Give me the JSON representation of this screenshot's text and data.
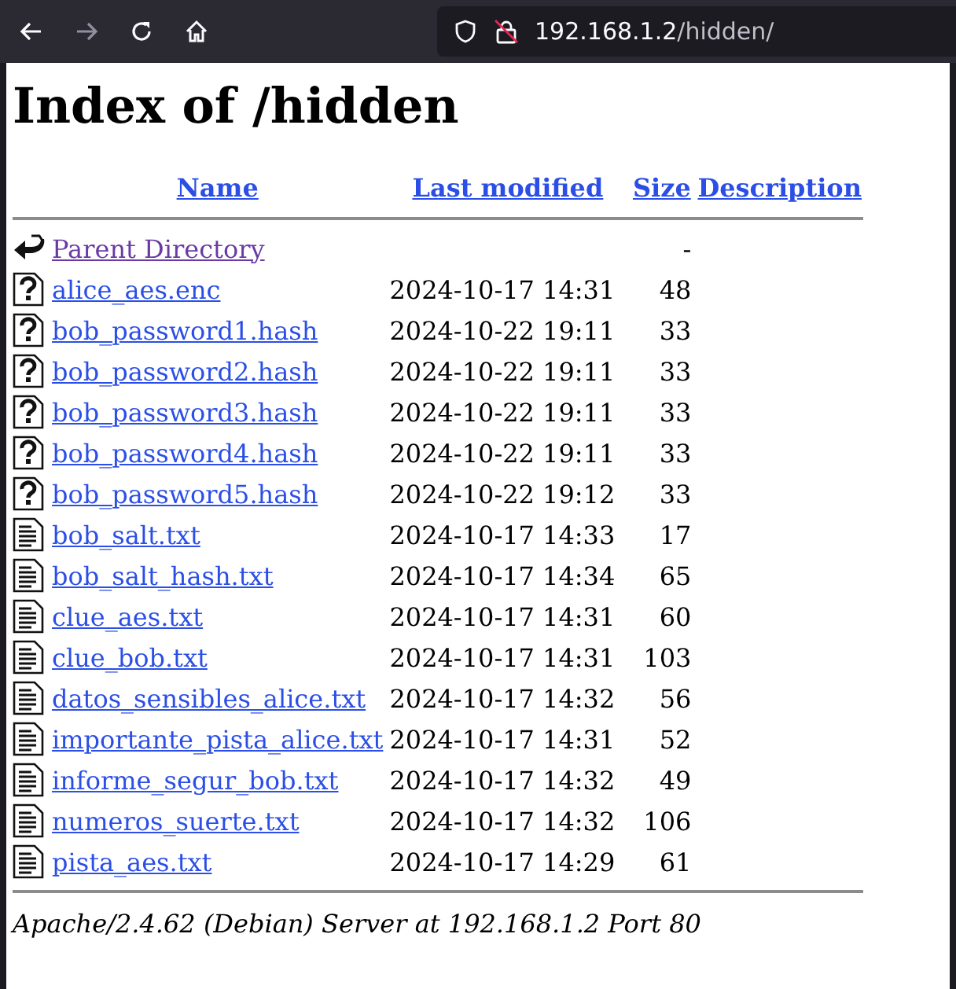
{
  "browser": {
    "url_host": "192.168.1.2",
    "url_path": "/hidden/"
  },
  "heading": "Index of /hidden",
  "columns": [
    "Name",
    "Last modified",
    "Size",
    "Description"
  ],
  "rows": [
    {
      "kind": "parent",
      "name": "Parent Directory",
      "visited": true,
      "modified": "",
      "size": "-"
    },
    {
      "kind": "unknown",
      "name": "alice_aes.enc",
      "visited": false,
      "modified": "2024-10-17 14:31",
      "size": "48"
    },
    {
      "kind": "unknown",
      "name": "bob_password1.hash",
      "visited": false,
      "modified": "2024-10-22 19:11",
      "size": "33"
    },
    {
      "kind": "unknown",
      "name": "bob_password2.hash",
      "visited": false,
      "modified": "2024-10-22 19:11",
      "size": "33"
    },
    {
      "kind": "unknown",
      "name": "bob_password3.hash",
      "visited": false,
      "modified": "2024-10-22 19:11",
      "size": "33"
    },
    {
      "kind": "unknown",
      "name": "bob_password4.hash",
      "visited": false,
      "modified": "2024-10-22 19:11",
      "size": "33"
    },
    {
      "kind": "unknown",
      "name": "bob_password5.hash",
      "visited": false,
      "modified": "2024-10-22 19:12",
      "size": "33"
    },
    {
      "kind": "text",
      "name": "bob_salt.txt",
      "visited": false,
      "modified": "2024-10-17 14:33",
      "size": "17"
    },
    {
      "kind": "text",
      "name": "bob_salt_hash.txt",
      "visited": false,
      "modified": "2024-10-17 14:34",
      "size": "65"
    },
    {
      "kind": "text",
      "name": "clue_aes.txt",
      "visited": false,
      "modified": "2024-10-17 14:31",
      "size": "60"
    },
    {
      "kind": "text",
      "name": "clue_bob.txt",
      "visited": false,
      "modified": "2024-10-17 14:31",
      "size": "103"
    },
    {
      "kind": "text",
      "name": "datos_sensibles_alice.txt",
      "visited": false,
      "modified": "2024-10-17 14:32",
      "size": "56"
    },
    {
      "kind": "text",
      "name": "importante_pista_alice.txt",
      "visited": false,
      "modified": "2024-10-17 14:31",
      "size": "52"
    },
    {
      "kind": "text",
      "name": "informe_segur_bob.txt",
      "visited": false,
      "modified": "2024-10-17 14:32",
      "size": "49"
    },
    {
      "kind": "text",
      "name": "numeros_suerte.txt",
      "visited": false,
      "modified": "2024-10-17 14:32",
      "size": "106"
    },
    {
      "kind": "text",
      "name": "pista_aes.txt",
      "visited": false,
      "modified": "2024-10-17 14:29",
      "size": "61"
    }
  ],
  "footer": "Apache/2.4.62 (Debian) Server at 192.168.1.2 Port 80"
}
